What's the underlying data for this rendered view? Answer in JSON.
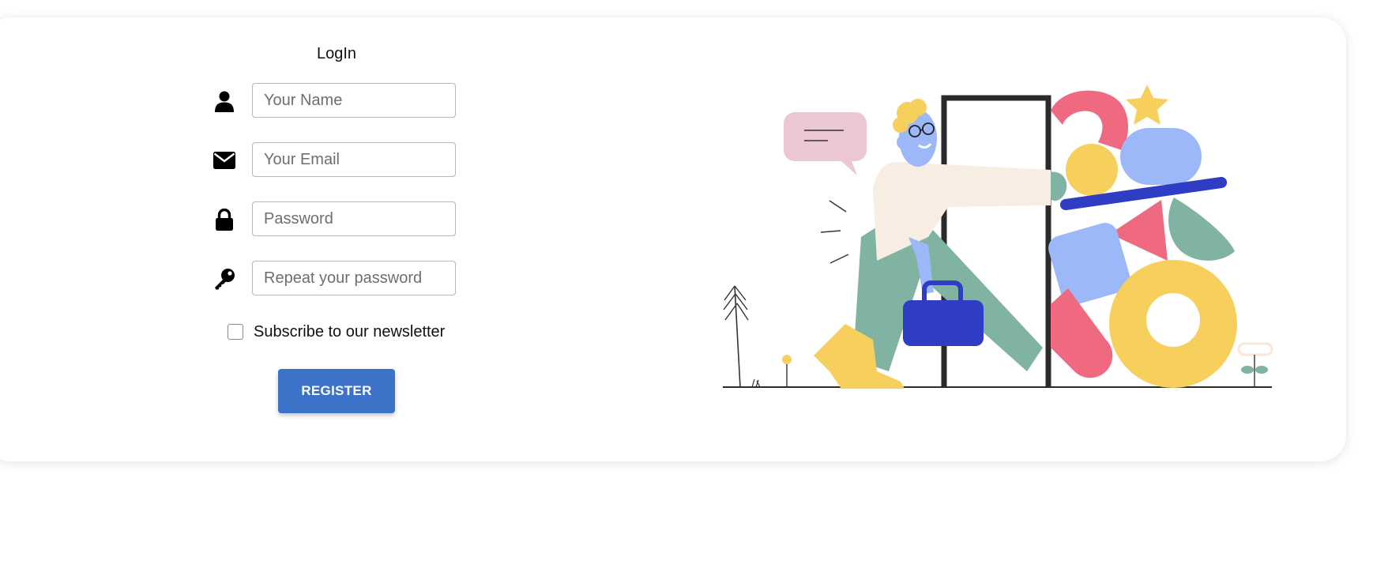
{
  "form": {
    "title": "LogIn",
    "fields": [
      {
        "placeholder": "Your Name",
        "value": "",
        "icon": "user-icon"
      },
      {
        "placeholder": "Your Email",
        "value": "",
        "icon": "envelope-icon"
      },
      {
        "placeholder": "Password",
        "value": "",
        "icon": "lock-icon"
      },
      {
        "placeholder": "Repeat your password",
        "value": "",
        "icon": "key-icon"
      }
    ],
    "newsletter": {
      "label": "Subscribe to our newsletter",
      "checked": false
    },
    "register_label": "REGISTER"
  },
  "colors": {
    "accent": "#3d72c9",
    "illustration_pink": "#ef6a80",
    "illustration_yellow": "#f7cf5d",
    "illustration_blue": "#9cb8f8",
    "illustration_green": "#80b3a2",
    "illustration_navy": "#2f3dc5"
  }
}
